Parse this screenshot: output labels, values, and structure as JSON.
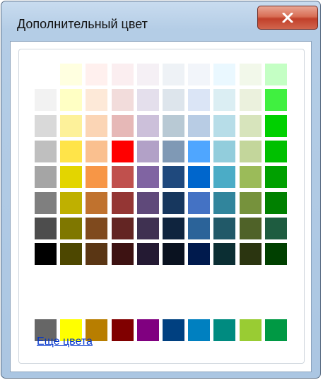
{
  "window": {
    "title": "Дополнительный цвет",
    "close_icon": "close-x-icon"
  },
  "palette": {
    "rows": [
      [
        "#ffffff",
        "#ffffe0",
        "#fff0ee",
        "#fbeef0",
        "#f5f0f5",
        "#eef2f6",
        "#f2f5fa",
        "#eaf8ff",
        "#f2f8ea",
        "#c4ffc4"
      ],
      [
        "#f2f2f2",
        "#ffffc4",
        "#fde9d8",
        "#f2dcdb",
        "#e4dfec",
        "#dde5ec",
        "#dbe5f6",
        "#dbeef3",
        "#ebf1dd",
        "#40f040"
      ],
      [
        "#d9d9d9",
        "#fdf19a",
        "#fbd5b5",
        "#e6b8b7",
        "#ccc0da",
        "#b8c9d4",
        "#b8cce4",
        "#b7dde8",
        "#d7e4bc",
        "#00d000"
      ],
      [
        "#bfbfbf",
        "#ffe449",
        "#fac08f",
        "#ff0000",
        "#b2a1c7",
        "#7f99b5",
        "#4fa6ff",
        "#92cddc",
        "#c3d69b",
        "#00c000"
      ],
      [
        "#a5a5a5",
        "#e3d500",
        "#f79646",
        "#c0504d",
        "#8064a2",
        "#1f497d",
        "#0066cc",
        "#4bacc6",
        "#9bbb59",
        "#00a000"
      ],
      [
        "#7f7f7f",
        "#bfb000",
        "#c0722e",
        "#943634",
        "#5f497a",
        "#17375e",
        "#4472c4",
        "#31859c",
        "#76923c",
        "#008000"
      ],
      [
        "#4d4d4d",
        "#7f7700",
        "#7f4a1e",
        "#632523",
        "#3f3151",
        "#0f243e",
        "#2b6399",
        "#215968",
        "#4f6228",
        "#1e5c40"
      ],
      [
        "#000000",
        "#4d4700",
        "#5a3614",
        "#3d1212",
        "#241a33",
        "#0a1220",
        "#001a4d",
        "#0b2e33",
        "#2b3510",
        "#004000"
      ]
    ],
    "standard": [
      "#666666",
      "#ffff00",
      "#b87e00",
      "#800000",
      "#800080",
      "#004080",
      "#0080c0",
      "#008b80",
      "#99cc33",
      "#009944"
    ]
  },
  "more_colors_link": "Еще цвета"
}
